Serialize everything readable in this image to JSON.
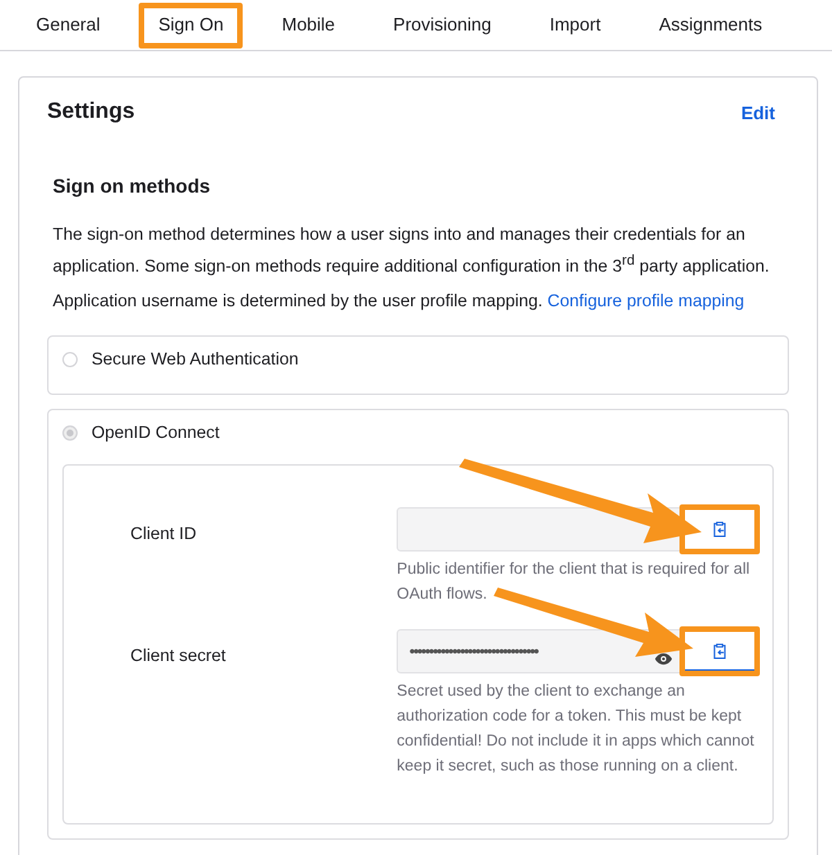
{
  "tabs": [
    {
      "label": "General",
      "selected": false
    },
    {
      "label": "Sign On",
      "selected": true
    },
    {
      "label": "Mobile",
      "selected": false
    },
    {
      "label": "Provisioning",
      "selected": false
    },
    {
      "label": "Import",
      "selected": false
    },
    {
      "label": "Assignments",
      "selected": false
    }
  ],
  "settings": {
    "title": "Settings",
    "edit": "Edit",
    "section_title": "Sign on methods",
    "description": "The sign-on method determines how a user signs into and manages their credentials for an application. Some sign-on methods require additional configuration in the 3$^{rd}$ party application.",
    "username_note": "Application username is determined by the user profile mapping.",
    "username_link": "Configure profile mapping",
    "methods": [
      {
        "label": "Secure Web Authentication",
        "selected": false
      },
      {
        "label": "OpenID Connect",
        "selected": true
      }
    ],
    "fields": [
      {
        "label": "Client ID",
        "masked": false,
        "help": "Public identifier for the client that is required for all OAuth flows."
      },
      {
        "label": "Client secret",
        "value": "•••••••••••••••••••••••••••••••••",
        "masked": true,
        "help": "Secret used by the client to exchange an authorization code for a token. This must be kept confidential! Do not include it in apps which cannot keep it secret, such as those running on a client."
      }
    ]
  }
}
